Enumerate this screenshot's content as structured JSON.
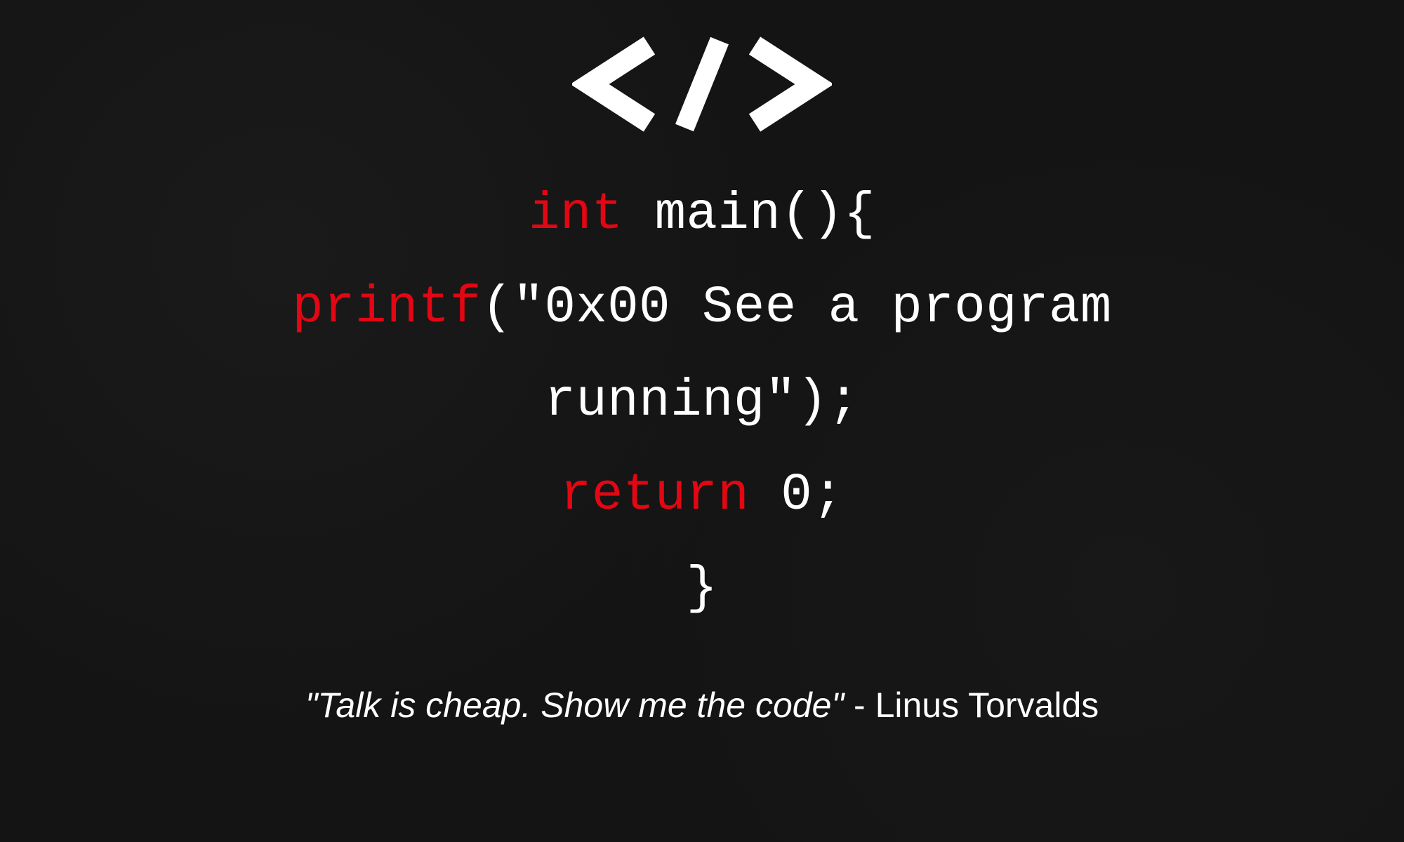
{
  "icon": {
    "name": "code-tag-icon"
  },
  "code": {
    "line1_kw": "int",
    "line1_rest": " main(){",
    "line2_kw": "printf",
    "line2_rest": "(\"0x00 See a program",
    "line3": "running\");",
    "line4_kw": "return",
    "line4_rest": " 0;",
    "line5": "}"
  },
  "quote": {
    "text": "\"Talk is cheap. Show me the code\"",
    "attribution": " - Linus Torvalds"
  },
  "colors": {
    "background": "#141414",
    "text": "#ffffff",
    "keyword": "#e30613"
  }
}
